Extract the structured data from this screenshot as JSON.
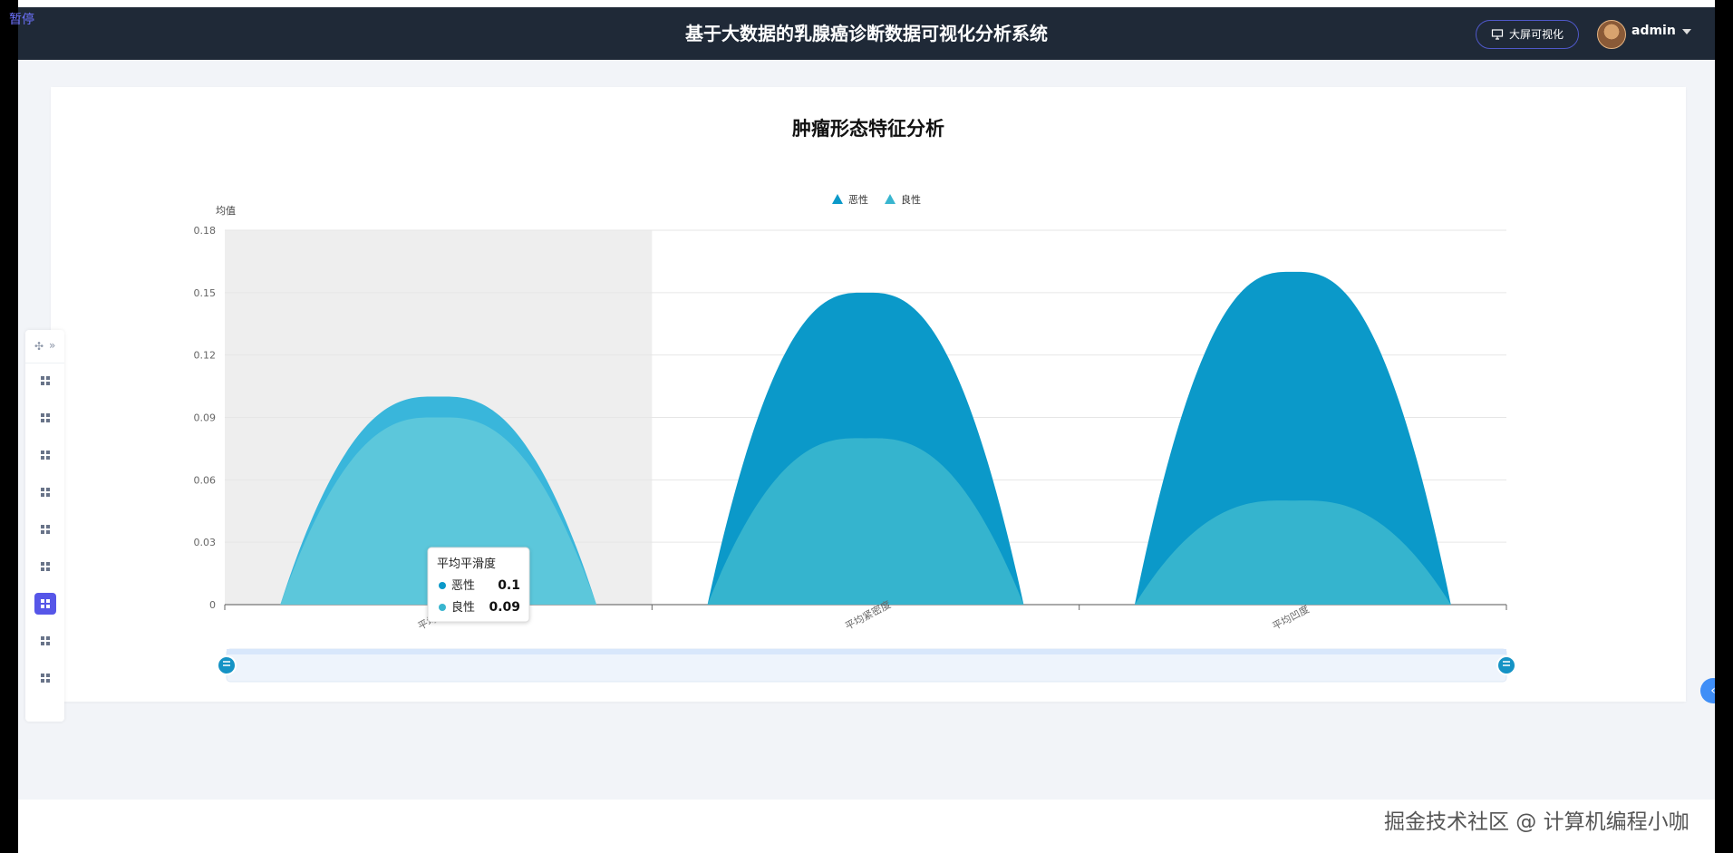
{
  "overlay": {
    "pause_text": "暂停"
  },
  "header": {
    "title": "基于大数据的乳腺癌诊断数据可视化分析系统",
    "screen_button": "大屏可视化",
    "user": "admin"
  },
  "sidebar": {
    "items": [
      "grid-icon",
      "grid-icon",
      "grid-icon",
      "grid-icon",
      "grid-icon",
      "grid-icon",
      "grid-icon",
      "grid-icon",
      "grid-icon"
    ],
    "active_index": 6
  },
  "chart_data": {
    "type": "area",
    "title": "肿瘤形态特征分析",
    "ylabel": "均值",
    "categories": [
      "平均平滑度",
      "平均紧密度",
      "平均凹度"
    ],
    "ylim": [
      0,
      0.18
    ],
    "y_ticks": [
      "0",
      "0.03",
      "0.06",
      "0.09",
      "0.12",
      "0.15",
      "0.18"
    ],
    "series": [
      {
        "name": "恶性",
        "values": [
          0.1,
          0.15,
          0.16
        ],
        "color": "#0b99c9"
      },
      {
        "name": "良性",
        "values": [
          0.09,
          0.08,
          0.05
        ],
        "color": "#38b5cf"
      }
    ],
    "tooltip": {
      "category": "平均平滑度",
      "rows": [
        {
          "name": "恶性",
          "value": "0.1"
        },
        {
          "name": "良性",
          "value": "0.09"
        }
      ]
    },
    "legend": "top-center",
    "highlight_category_index": 0
  },
  "watermark": "掘金技术社区 @ 计算机编程小咖"
}
